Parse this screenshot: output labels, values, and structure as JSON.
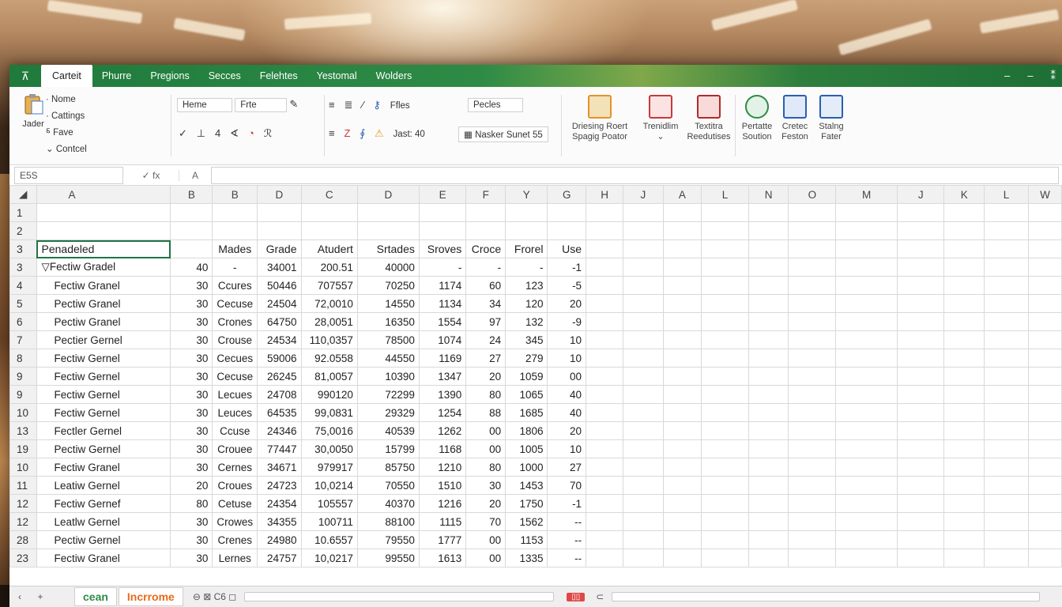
{
  "ribbon_tabs": [
    "Carteit",
    "Phurre",
    "Pregions",
    "Secces",
    "Felehtes",
    "Yestomal",
    "Wolders"
  ],
  "window_controls": [
    "–",
    "–",
    "⁑"
  ],
  "ribbon": {
    "clipboard_label": "Jader",
    "clipboard_items": [
      "Nome",
      "Cattings",
      "Fave",
      "Contcel"
    ],
    "font_name": "Heme",
    "font_size": "Frte",
    "files_label": "Ffles",
    "last_label": "Jast: 40",
    "pecles_label": "Pecles",
    "masker_label": "Nasker Sunet 55",
    "big_buttons": [
      {
        "line1": "Driesing Roert",
        "line2": "Spagig Poator"
      },
      {
        "line1": "Trenidlim",
        "line2": ""
      },
      {
        "line1": "Textitra",
        "line2": "Reedutises"
      },
      {
        "line1": "Pertatte",
        "line2": "Soution"
      },
      {
        "line1": "Cretec",
        "line2": "Feston"
      },
      {
        "line1": "Stalng",
        "line2": "Fater"
      }
    ]
  },
  "formula_bar": {
    "name_box": "E5S",
    "fx": "✓   fx",
    "col": "A",
    "value": ""
  },
  "columns": [
    "A",
    "B",
    "B",
    "D",
    "C",
    "D",
    "E",
    "F",
    "Y",
    "G",
    "H",
    "J",
    "A",
    "L",
    "N",
    "O",
    "M",
    "J",
    "K",
    "L",
    "W"
  ],
  "rows": [
    {
      "rh": "1",
      "cells": []
    },
    {
      "rh": "2",
      "cells": []
    },
    {
      "rh": "3",
      "header": true,
      "cells": [
        "Penadeled",
        "",
        "Mades",
        "Grade",
        "Atudert",
        "Srtades",
        "Sroves",
        "Croce",
        "Frorel",
        "Use"
      ]
    },
    {
      "rh": "3",
      "cells": [
        "▽Fectiw Gradel",
        "40",
        "-",
        "34001",
        "200.51",
        "40000",
        "-",
        "-",
        "-",
        "-1"
      ]
    },
    {
      "rh": "4",
      "cells": [
        "Fectiw Granel",
        "30",
        "Ccures",
        "50446",
        "707557",
        "70250",
        "1174",
        "60",
        "123",
        "-5"
      ]
    },
    {
      "rh": "5",
      "cells": [
        "Pectiw Granel",
        "30",
        "Cecuse",
        "24504",
        "72,0010",
        "14550",
        "1134",
        "34",
        "120",
        "20"
      ]
    },
    {
      "rh": "6",
      "cells": [
        "Pectiw Granel",
        "30",
        "Crones",
        "64750",
        "28,0051",
        "16350",
        "1554",
        "97",
        "132",
        "-9"
      ]
    },
    {
      "rh": "7",
      "cells": [
        "Pectier Gernel",
        "30",
        "Crouse",
        "24534",
        "110,0357",
        "78500",
        "1074",
        "24",
        "345",
        "10"
      ]
    },
    {
      "rh": "8",
      "cells": [
        "Fectiw Gernel",
        "30",
        "Cecues",
        "59006",
        "92.0558",
        "44550",
        "1169",
        "27",
        "279",
        "10"
      ]
    },
    {
      "rh": "9",
      "cells": [
        "Fectiw Gernel",
        "30",
        "Cecuse",
        "26245",
        "81,0057",
        "10390",
        "1347",
        "20",
        "1059",
        "00"
      ]
    },
    {
      "rh": "9",
      "cells": [
        "Fectiw Gernel",
        "30",
        "Lecues",
        "24708",
        "990120",
        "72299",
        "1390",
        "80",
        "1065",
        "40"
      ]
    },
    {
      "rh": "10",
      "cells": [
        "Fectiw Gernel",
        "30",
        "Leuces",
        "64535",
        "99,0831",
        "29329",
        "1254",
        "88",
        "1685",
        "40"
      ]
    },
    {
      "rh": "13",
      "cells": [
        "Fectler Gernel",
        "30",
        "Ccuse",
        "24346",
        "75,0016",
        "40539",
        "1262",
        "00",
        "1806",
        "20"
      ]
    },
    {
      "rh": "19",
      "cells": [
        "Pectiw Gernel",
        "30",
        "Crouee",
        "77447",
        "30,0050",
        "15799",
        "1168",
        "00",
        "1005",
        "10"
      ]
    },
    {
      "rh": "10",
      "cells": [
        "Fectiw Granel",
        "30",
        "Cernes",
        "34671",
        "979917",
        "85750",
        "1210",
        "80",
        "1000",
        "27"
      ]
    },
    {
      "rh": "11",
      "cells": [
        "Leatiw Gernel",
        "20",
        "Croues",
        "24723",
        "10,0214",
        "70550",
        "1510",
        "30",
        "1453",
        "70"
      ]
    },
    {
      "rh": "12",
      "cells": [
        "Fectiw Gernef",
        "80",
        "Cetuse",
        "24354",
        "105557",
        "40370",
        "1216",
        "20",
        "1750",
        "-1"
      ]
    },
    {
      "rh": "12",
      "cells": [
        "Leatlw Gernel",
        "30",
        "Crowes",
        "34355",
        "100711",
        "88100",
        "1115",
        "70",
        "1562",
        "--"
      ]
    },
    {
      "rh": "28",
      "cells": [
        "Pectiw Gernel",
        "30",
        "Crenes",
        "24980",
        "10.6557",
        "79550",
        "1777",
        "00",
        "1153",
        "--"
      ]
    },
    {
      "rh": "23",
      "cells": [
        "Fectiw Granel",
        "30",
        "Lernes",
        "24757",
        "10,0217",
        "99550",
        "1613",
        "00",
        "1335",
        "--"
      ]
    }
  ],
  "sheet_tabs": [
    "cean",
    "Incrrome"
  ],
  "status_mid": "⊖  ⊠  C6 ◻",
  "status_badge": "▯▯",
  "colors": {
    "accent": "#217346",
    "tab_green": "#2e8b46",
    "tab_orange": "#e66c1a"
  }
}
